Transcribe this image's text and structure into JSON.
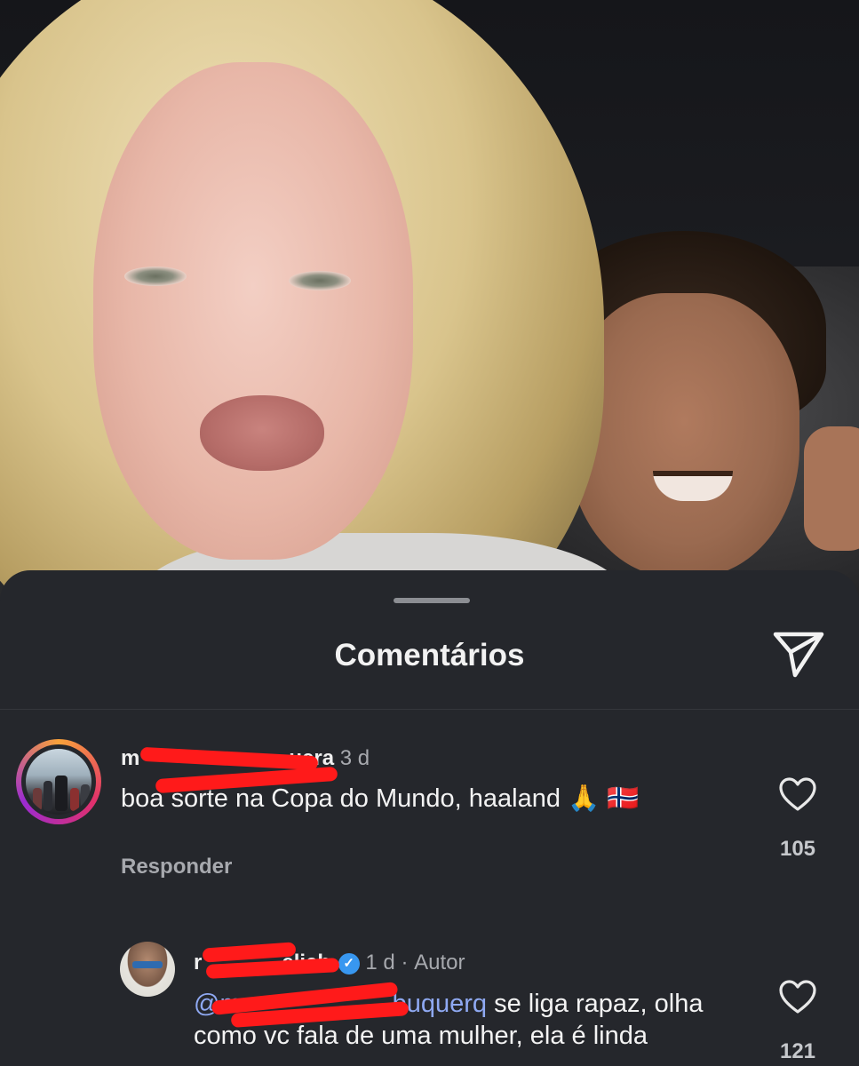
{
  "sheet": {
    "title": "Comentários"
  },
  "comments": [
    {
      "username_visible_start": "m",
      "username_visible_end": "uera",
      "time": "3 d",
      "text": "boa sorte na Copa do Mundo, haaland",
      "emoji": "🙏",
      "flag_emoji": "🇳🇴",
      "reply_label": "Responder",
      "likes": "105"
    },
    {
      "username_visible_start": "r",
      "username_visible_end": "elich",
      "verified": true,
      "time": "1 d",
      "separator": "·",
      "author_label": "Autor",
      "mention_start": "@m",
      "mention_end": "buquerq",
      "text_line1": "se liga rapaz, olha",
      "text_line2": "como vc fala de uma mulher, ela é linda",
      "likes": "121"
    }
  ],
  "icons": {
    "send": "send-icon",
    "heart": "heart-icon",
    "verified": "verified-badge-icon"
  },
  "colors": {
    "sheet_bg": "#25272c",
    "mention": "#8fa9f2",
    "redaction": "#ff1a1a",
    "verified": "#3897f0"
  }
}
